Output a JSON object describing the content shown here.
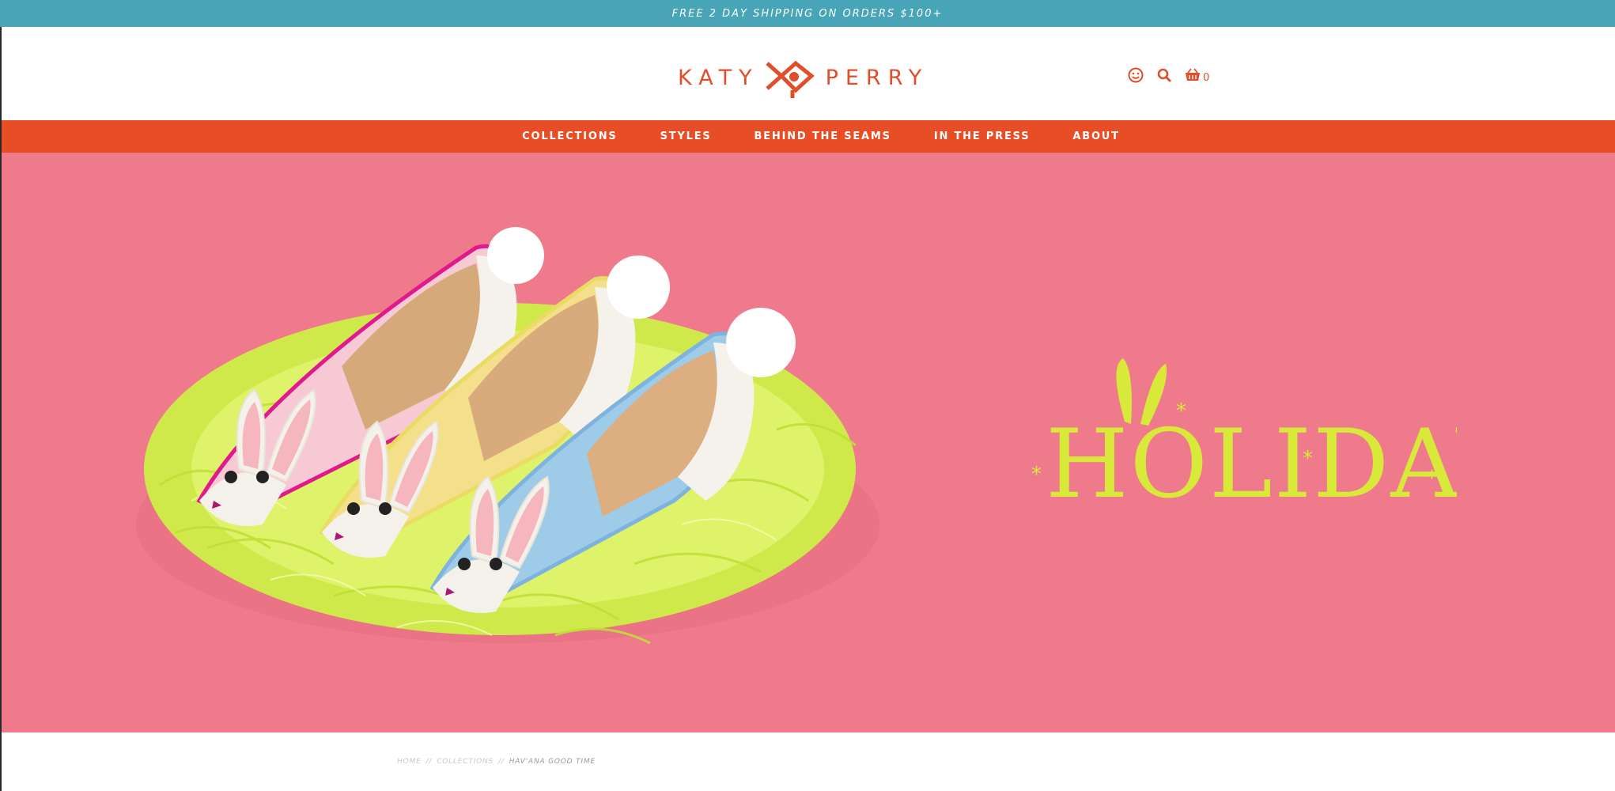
{
  "promo": {
    "text": "FREE 2 DAY SHIPPING ON ORDERS $100+"
  },
  "header": {
    "logo_left": "KATY",
    "logo_right": "PERRY",
    "icons": [
      "smiley-account-icon",
      "search-icon",
      "basket-cart-icon"
    ],
    "cart_count": "0"
  },
  "nav": {
    "items": [
      {
        "label": "COLLECTIONS"
      },
      {
        "label": "STYLES"
      },
      {
        "label": "BEHIND THE SEAMS"
      },
      {
        "label": "IN THE PRESS"
      },
      {
        "label": "ABOUT"
      }
    ]
  },
  "hero": {
    "headline": "HOLIDAY",
    "image": "bunny-flats-on-easter-grass"
  },
  "breadcrumb": {
    "home": "HOME",
    "sep1": "//",
    "collections": "COLLECTIONS",
    "sep2": "//",
    "current": "HAV'ANA GOOD TIME"
  },
  "colors": {
    "promo_bg": "#48a5b7",
    "brand_orange": "#e04e2a",
    "nav_bg": "#e84e26",
    "hero_bg": "#ef7a8c",
    "headline": "#d8e93a"
  }
}
